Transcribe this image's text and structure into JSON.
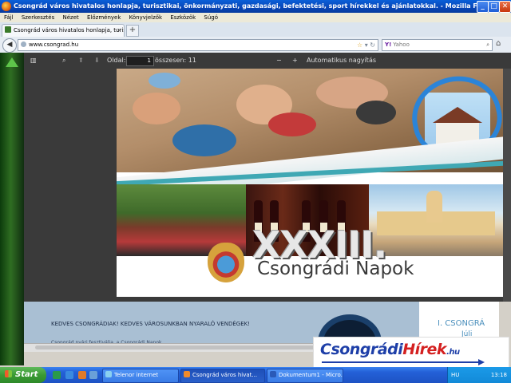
{
  "window": {
    "title": "Csongrád város hivatalos honlapja, turisztikai, önkormányzati, gazdasági, befektetési, sport hírekkel és ajánlatokkal. - Mozilla Firefox",
    "minimize": "_",
    "maximize": "□",
    "close": "✕"
  },
  "menu": {
    "items": [
      "Fájl",
      "Szerkesztés",
      "Nézet",
      "Előzmények",
      "Könyvjelzők",
      "Eszközök",
      "Súgó"
    ]
  },
  "tabs": {
    "active_label": "Csongrád város hivatalos honlapja, turisztik...",
    "close": "×",
    "new_tab": "+"
  },
  "nav": {
    "back": "◀",
    "url": "www.csongrad.hu",
    "bookmark_star": "☆",
    "search_engine": "Y!",
    "search_placeholder": "Yahoo",
    "home": "⌂"
  },
  "pdf_toolbar": {
    "page_label": "Oldal:",
    "page_value": "1",
    "total_label": "összesen: 11",
    "zoom_out": "−",
    "zoom_in": "+",
    "zoom_mode": "Automatikus nagyítás"
  },
  "banner": {
    "roman": "XXXIII.",
    "subtitle": "Csongrádi Napok"
  },
  "page2": {
    "greeting": "KEDVES CSONGRÁDIAK! KEDVES VÁROSUNKBAN NYARALÓ VENDÉGEK!",
    "faint": "Csongrád nyári fesztiválja, a Csongrádi Napok...",
    "side_text": "I. CSONGRÁ",
    "side_sub": "Júli"
  },
  "watermark": {
    "brand_a": "Csongrádi",
    "brand_b": "Hírek",
    "tld": ".hu"
  },
  "taskbar": {
    "start": "Start",
    "buttons": [
      "Telenor internet",
      "Csongrád város hivat...",
      "Dokumentum1 - Micro..."
    ],
    "tray_text": "HU",
    "clock": "13:18"
  },
  "colors": {
    "titlebar": "#0846b8",
    "taskbar": "#2461d8",
    "start": "#3a9a34",
    "pdf_dark": "#3a3a3a",
    "brand_blue": "#1e3fa8",
    "brand_red": "#d42020"
  }
}
